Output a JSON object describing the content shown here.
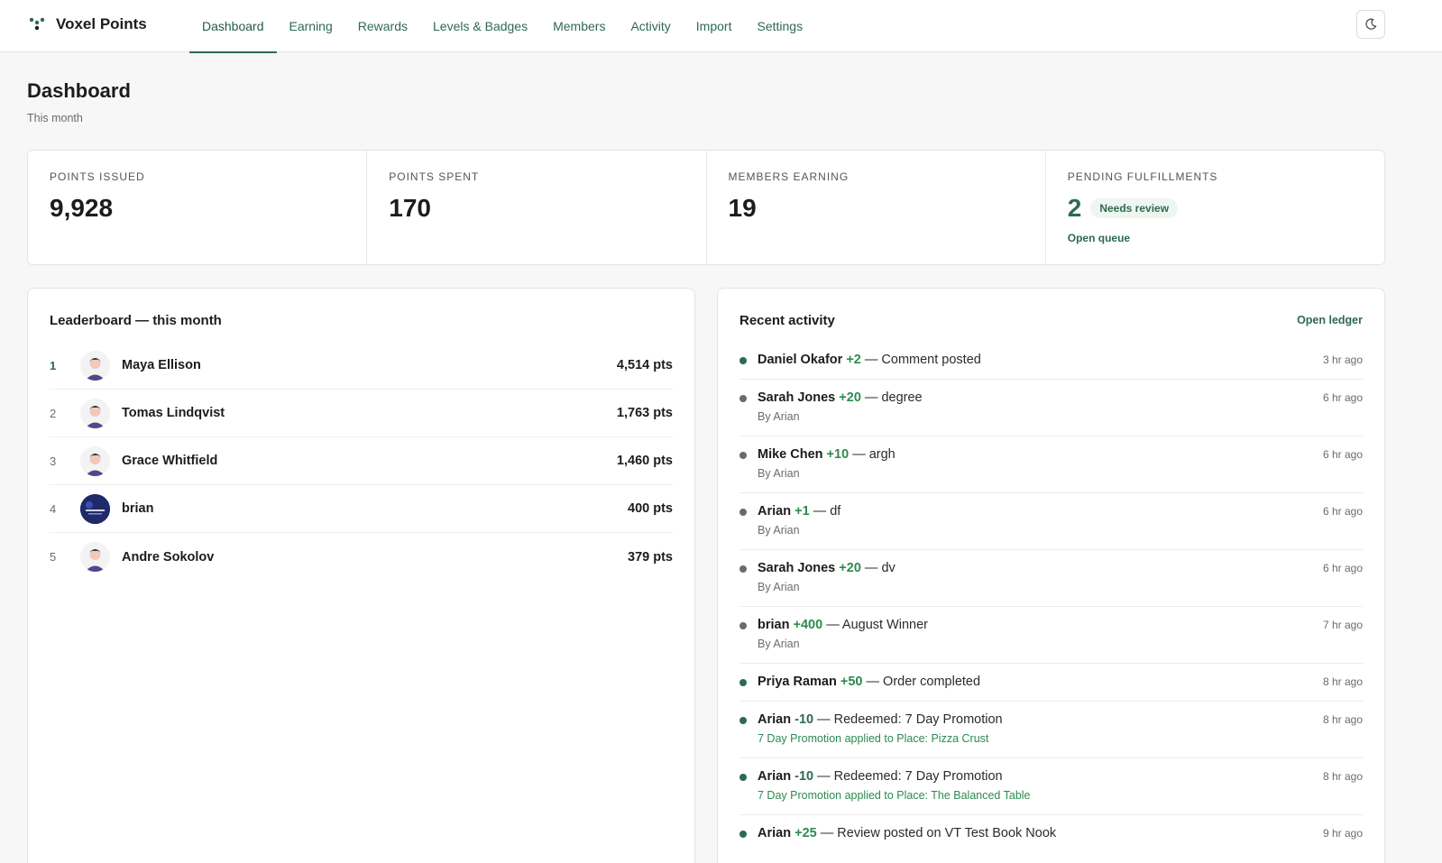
{
  "app": {
    "name": "Voxel Points"
  },
  "nav": {
    "items": [
      {
        "label": "Dashboard"
      },
      {
        "label": "Earning"
      },
      {
        "label": "Rewards"
      },
      {
        "label": "Levels & Badges"
      },
      {
        "label": "Members"
      },
      {
        "label": "Activity"
      },
      {
        "label": "Import"
      },
      {
        "label": "Settings"
      }
    ],
    "active_index": 0,
    "theme_toggle_icon": "moon-icon"
  },
  "page": {
    "title": "Dashboard",
    "subtitle": "This month"
  },
  "stats": [
    {
      "label": "POINTS ISSUED",
      "value": "9,928"
    },
    {
      "label": "POINTS SPENT",
      "value": "170"
    },
    {
      "label": "MEMBERS EARNING",
      "value": "19"
    },
    {
      "label": "PENDING FULFILLMENTS",
      "value": "2",
      "badge": "Needs review",
      "link": "Open queue"
    }
  ],
  "leaderboard": {
    "title": "Leaderboard — this month",
    "rows": [
      {
        "rank": "1",
        "name": "Maya Ellison",
        "points": "4,514 pts",
        "avatar": "person-avatar-icon"
      },
      {
        "rank": "2",
        "name": "Tomas Lindqvist",
        "points": "1,763 pts",
        "avatar": "person-avatar-icon"
      },
      {
        "rank": "3",
        "name": "Grace Whitfield",
        "points": "1,460 pts",
        "avatar": "person-avatar-icon"
      },
      {
        "rank": "4",
        "name": "brian",
        "points": "400 pts",
        "avatar": "photo-avatar-icon"
      },
      {
        "rank": "5",
        "name": "Andre Sokolov",
        "points": "379 pts",
        "avatar": "person-avatar-icon"
      }
    ]
  },
  "activity": {
    "title": "Recent activity",
    "link": "Open ledger",
    "items": [
      {
        "name": "Daniel Okafor",
        "points": "+2",
        "desc": "— Comment posted",
        "sub": "",
        "time": "3 hr ago",
        "dot": "green"
      },
      {
        "name": "Sarah Jones",
        "points": "+20",
        "desc": "— degree",
        "sub": "By Arian",
        "time": "6 hr ago",
        "dot": "gray"
      },
      {
        "name": "Mike Chen",
        "points": "+10",
        "desc": "— argh",
        "sub": "By Arian",
        "time": "6 hr ago",
        "dot": "gray"
      },
      {
        "name": "Arian",
        "points": "+1",
        "desc": "— df",
        "sub": "By Arian",
        "time": "6 hr ago",
        "dot": "gray"
      },
      {
        "name": "Sarah Jones",
        "points": "+20",
        "desc": "— dv",
        "sub": "By Arian",
        "time": "6 hr ago",
        "dot": "gray"
      },
      {
        "name": "brian",
        "points": "+400",
        "desc": "— August Winner",
        "sub": "By Arian",
        "time": "7 hr ago",
        "dot": "gray"
      },
      {
        "name": "Priya Raman",
        "points": "+50",
        "desc": "— Order completed",
        "sub": "",
        "time": "8 hr ago",
        "dot": "green"
      },
      {
        "name": "Arian",
        "points": "-10",
        "desc": "— Redeemed: 7 Day Promotion",
        "sub": "7 Day Promotion applied to Place: Pizza Crust",
        "time": "8 hr ago",
        "dot": "green"
      },
      {
        "name": "Arian",
        "points": "-10",
        "desc": "— Redeemed: 7 Day Promotion",
        "sub": "7 Day Promotion applied to Place: The Balanced Table",
        "time": "8 hr ago",
        "dot": "green"
      },
      {
        "name": "Arian",
        "points": "+25",
        "desc": "— Review posted on VT Test Book Nook",
        "sub": "",
        "time": "9 hr ago",
        "dot": "green"
      }
    ]
  },
  "colors": {
    "accent": "#2d6a4f",
    "positive": "#2d8a4f",
    "muted": "#6b6b6b"
  }
}
